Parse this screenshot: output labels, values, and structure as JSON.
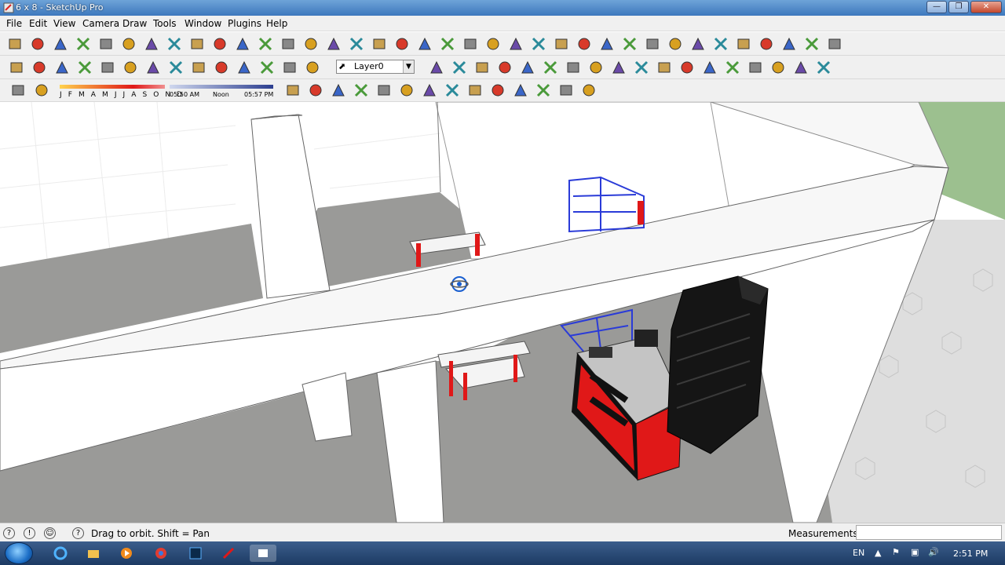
{
  "window": {
    "title": "6 x 8 - SketchUp Pro"
  },
  "menu": [
    "File",
    "Edit",
    "View",
    "Camera",
    "Draw",
    "Tools",
    "Window",
    "Plugins",
    "Help"
  ],
  "layer": {
    "current": "Layer0"
  },
  "shadow": {
    "months": "J F M A M J J A S O N D",
    "time_start": "05:50 AM",
    "time_mid": "Noon",
    "time_end": "05:57 PM"
  },
  "status": {
    "hint": "Drag to orbit.  Shift = Pan",
    "measurements_label": "Measurements",
    "measurements_value": ""
  },
  "tray": {
    "lang": "EN",
    "time": "2:51 PM"
  },
  "colors": {
    "accent_red": "#e01818",
    "shelf_blue": "#2a3bd8",
    "ground": "#9a9a98",
    "grass": "#9cc08f"
  },
  "icons": {
    "toolbar1": [
      "select-icon",
      "make-component-icon",
      "paint-bucket-icon",
      "eraser-icon",
      "rectangle-icon",
      "line-icon",
      "circle-icon",
      "arc-icon",
      "push-pull-icon",
      "rotate-icon",
      "offset-icon",
      "move-icon",
      "save-icon",
      "cut-icon",
      "copy-icon",
      "paste-icon",
      "delete-icon",
      "undo-icon",
      "redo-icon",
      "print-icon",
      "model-info-icon",
      "orbit-icon",
      "pan-icon",
      "zoom-icon",
      "zoom-window-icon",
      "zoom-extents-icon",
      "previous-view-icon",
      "next-view-icon",
      "sandbox-icon",
      "follow-me-icon",
      "rotate-3d-icon",
      "scale-icon",
      "tape-measure-icon",
      "axes-icon",
      "dimension-icon",
      "text-icon",
      "3d-text-icon"
    ],
    "toolbar2": [
      "group-icon",
      "component-icon",
      "outer-shell-icon",
      "intersect-icon",
      "union-icon",
      "subtract-icon",
      "iso-view-icon",
      "top-view-icon",
      "front-view-icon",
      "right-view-icon",
      "back-view-icon",
      "left-view-icon",
      "xray-icon",
      "wireframe-icon",
      "layer-arrow-icon",
      "layer-manager-icon",
      "material-icon",
      "tag-icon",
      "walk-icon",
      "help-icon",
      "measure-icon",
      "sphere-icon",
      "plugin-a-icon",
      "plugin-b-icon",
      "plugin-c-icon",
      "section-plane-icon",
      "orbit-target-icon",
      "house-face-icon",
      "house-side-icon",
      "house-top-icon",
      "house-outline-icon",
      "window-icon"
    ],
    "toolbar3": [
      "warehouse-icon",
      "pencil-upload-icon",
      "shadow-graph-icon",
      "walk-through-icon",
      "footprint-icon",
      "eye-icon",
      "photo-match-icon",
      "extension-icon",
      "camera-icon",
      "style-icon",
      "dynamic-icon",
      "fog-icon",
      "scene-icon",
      "share-icon"
    ]
  }
}
